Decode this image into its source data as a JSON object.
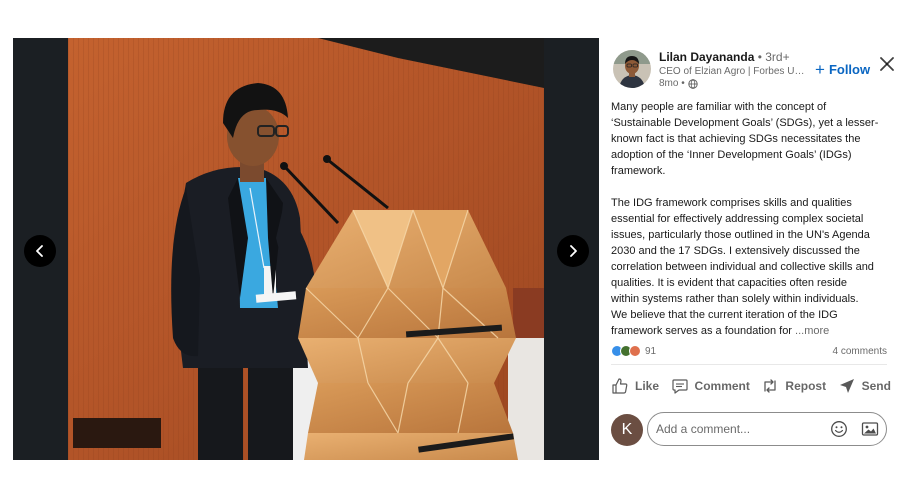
{
  "author": {
    "name": "Lilan Dayananda",
    "degree": "• 3rd+",
    "headline": "CEO of Elzian Agro | Forbes Under 30",
    "time": "8mo •",
    "follow_label": "Follow"
  },
  "post": {
    "paragraphs": [
      "Many people are familiar with the concept of\n‘Sustainable Development Goals’ (SDGs), yet a lesser-\nknown fact is that achieving SDGs necessitates the\nadoption of the ‘Inner Development Goals’ (IDGs)\nframework.",
      "The IDG framework comprises skills and qualities\nessential for effectively addressing complex societal\nissues, particularly those outlined in the UN's Agenda\n2030 and the 17 SDGs. I extensively discussed the\ncorrelation between individual and collective skills and\nqualities. It is evident that capacities often reside\nwithin systems rather than solely within individuals.\nWe believe that the current iteration of the IDG\nframework serves as a foundation for"
    ],
    "more_label": "...more"
  },
  "social": {
    "reaction_count": "91",
    "comments_label": "4 comments"
  },
  "actions": {
    "like": "Like",
    "comment": "Comment",
    "repost": "Repost",
    "send": "Send"
  },
  "comment_box": {
    "avatar_initial": "K",
    "placeholder": "Add a comment..."
  },
  "colors": {
    "accent": "#0a66c2",
    "media_background": "#1b1f23",
    "commenter_avatar": "#6b4e42"
  },
  "icons": [
    "chevron-left-icon",
    "chevron-right-icon",
    "close-icon",
    "globe-icon",
    "plus-icon",
    "like-icon",
    "comment-icon",
    "repost-icon",
    "send-icon",
    "emoji-icon",
    "image-icon"
  ]
}
